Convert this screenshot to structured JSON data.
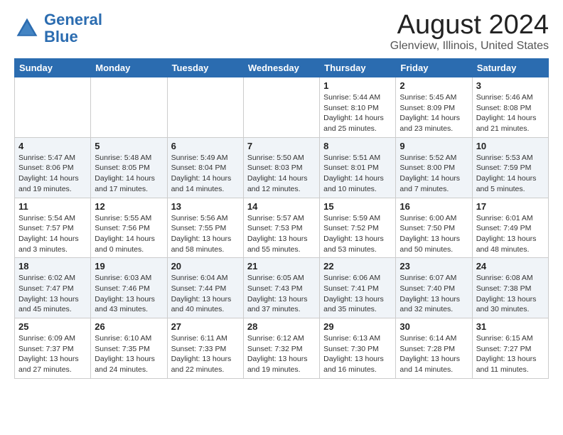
{
  "logo": {
    "text_general": "General",
    "text_blue": "Blue"
  },
  "header": {
    "title": "August 2024",
    "subtitle": "Glenview, Illinois, United States"
  },
  "weekdays": [
    "Sunday",
    "Monday",
    "Tuesday",
    "Wednesday",
    "Thursday",
    "Friday",
    "Saturday"
  ],
  "weeks": [
    [
      {
        "day": "",
        "info": ""
      },
      {
        "day": "",
        "info": ""
      },
      {
        "day": "",
        "info": ""
      },
      {
        "day": "",
        "info": ""
      },
      {
        "day": "1",
        "info": "Sunrise: 5:44 AM\nSunset: 8:10 PM\nDaylight: 14 hours\nand 25 minutes."
      },
      {
        "day": "2",
        "info": "Sunrise: 5:45 AM\nSunset: 8:09 PM\nDaylight: 14 hours\nand 23 minutes."
      },
      {
        "day": "3",
        "info": "Sunrise: 5:46 AM\nSunset: 8:08 PM\nDaylight: 14 hours\nand 21 minutes."
      }
    ],
    [
      {
        "day": "4",
        "info": "Sunrise: 5:47 AM\nSunset: 8:06 PM\nDaylight: 14 hours\nand 19 minutes."
      },
      {
        "day": "5",
        "info": "Sunrise: 5:48 AM\nSunset: 8:05 PM\nDaylight: 14 hours\nand 17 minutes."
      },
      {
        "day": "6",
        "info": "Sunrise: 5:49 AM\nSunset: 8:04 PM\nDaylight: 14 hours\nand 14 minutes."
      },
      {
        "day": "7",
        "info": "Sunrise: 5:50 AM\nSunset: 8:03 PM\nDaylight: 14 hours\nand 12 minutes."
      },
      {
        "day": "8",
        "info": "Sunrise: 5:51 AM\nSunset: 8:01 PM\nDaylight: 14 hours\nand 10 minutes."
      },
      {
        "day": "9",
        "info": "Sunrise: 5:52 AM\nSunset: 8:00 PM\nDaylight: 14 hours\nand 7 minutes."
      },
      {
        "day": "10",
        "info": "Sunrise: 5:53 AM\nSunset: 7:59 PM\nDaylight: 14 hours\nand 5 minutes."
      }
    ],
    [
      {
        "day": "11",
        "info": "Sunrise: 5:54 AM\nSunset: 7:57 PM\nDaylight: 14 hours\nand 3 minutes."
      },
      {
        "day": "12",
        "info": "Sunrise: 5:55 AM\nSunset: 7:56 PM\nDaylight: 14 hours\nand 0 minutes."
      },
      {
        "day": "13",
        "info": "Sunrise: 5:56 AM\nSunset: 7:55 PM\nDaylight: 13 hours\nand 58 minutes."
      },
      {
        "day": "14",
        "info": "Sunrise: 5:57 AM\nSunset: 7:53 PM\nDaylight: 13 hours\nand 55 minutes."
      },
      {
        "day": "15",
        "info": "Sunrise: 5:59 AM\nSunset: 7:52 PM\nDaylight: 13 hours\nand 53 minutes."
      },
      {
        "day": "16",
        "info": "Sunrise: 6:00 AM\nSunset: 7:50 PM\nDaylight: 13 hours\nand 50 minutes."
      },
      {
        "day": "17",
        "info": "Sunrise: 6:01 AM\nSunset: 7:49 PM\nDaylight: 13 hours\nand 48 minutes."
      }
    ],
    [
      {
        "day": "18",
        "info": "Sunrise: 6:02 AM\nSunset: 7:47 PM\nDaylight: 13 hours\nand 45 minutes."
      },
      {
        "day": "19",
        "info": "Sunrise: 6:03 AM\nSunset: 7:46 PM\nDaylight: 13 hours\nand 43 minutes."
      },
      {
        "day": "20",
        "info": "Sunrise: 6:04 AM\nSunset: 7:44 PM\nDaylight: 13 hours\nand 40 minutes."
      },
      {
        "day": "21",
        "info": "Sunrise: 6:05 AM\nSunset: 7:43 PM\nDaylight: 13 hours\nand 37 minutes."
      },
      {
        "day": "22",
        "info": "Sunrise: 6:06 AM\nSunset: 7:41 PM\nDaylight: 13 hours\nand 35 minutes."
      },
      {
        "day": "23",
        "info": "Sunrise: 6:07 AM\nSunset: 7:40 PM\nDaylight: 13 hours\nand 32 minutes."
      },
      {
        "day": "24",
        "info": "Sunrise: 6:08 AM\nSunset: 7:38 PM\nDaylight: 13 hours\nand 30 minutes."
      }
    ],
    [
      {
        "day": "25",
        "info": "Sunrise: 6:09 AM\nSunset: 7:37 PM\nDaylight: 13 hours\nand 27 minutes."
      },
      {
        "day": "26",
        "info": "Sunrise: 6:10 AM\nSunset: 7:35 PM\nDaylight: 13 hours\nand 24 minutes."
      },
      {
        "day": "27",
        "info": "Sunrise: 6:11 AM\nSunset: 7:33 PM\nDaylight: 13 hours\nand 22 minutes."
      },
      {
        "day": "28",
        "info": "Sunrise: 6:12 AM\nSunset: 7:32 PM\nDaylight: 13 hours\nand 19 minutes."
      },
      {
        "day": "29",
        "info": "Sunrise: 6:13 AM\nSunset: 7:30 PM\nDaylight: 13 hours\nand 16 minutes."
      },
      {
        "day": "30",
        "info": "Sunrise: 6:14 AM\nSunset: 7:28 PM\nDaylight: 13 hours\nand 14 minutes."
      },
      {
        "day": "31",
        "info": "Sunrise: 6:15 AM\nSunset: 7:27 PM\nDaylight: 13 hours\nand 11 minutes."
      }
    ]
  ]
}
